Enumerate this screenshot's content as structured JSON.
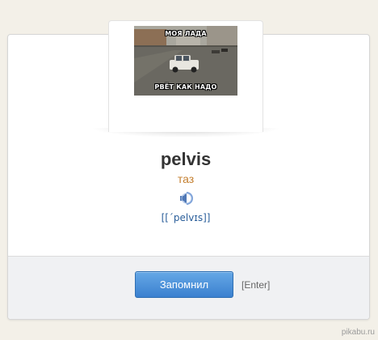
{
  "card": {
    "image": {
      "top_caption": "МОЯ ЛАДА",
      "bottom_caption": "РВЁТ КАК НАДО"
    },
    "word": "pelvis",
    "translation": "таз",
    "speaker_icon": "speaker-icon",
    "transcription": "[[´pelvɪs]]"
  },
  "footer": {
    "remember_button": "Запомнил",
    "enter_hint": "[Enter]"
  },
  "watermark": "pikabu.ru",
  "colors": {
    "background": "#f3f0e8",
    "translation": "#c47f2f",
    "transcription": "#2a5e9a",
    "button": "#3a80cf"
  }
}
